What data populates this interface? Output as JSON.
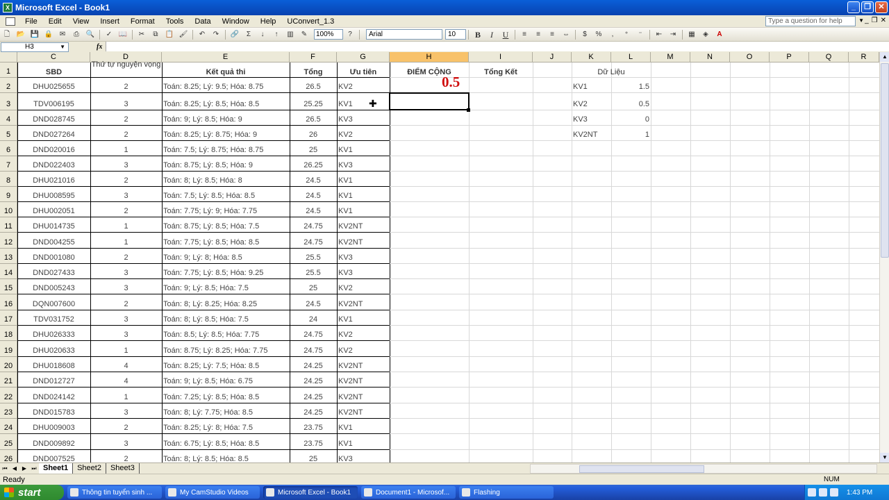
{
  "window": {
    "title": "Microsoft Excel - Book1"
  },
  "menu": {
    "items": [
      "File",
      "Edit",
      "View",
      "Insert",
      "Format",
      "Tools",
      "Data",
      "Window",
      "Help",
      "UConvert_1.3"
    ],
    "help_placeholder": "Type a question for help"
  },
  "toolbar": {
    "zoom": "100%",
    "font": "Arial",
    "size": "10"
  },
  "formula": {
    "namebox": "H3",
    "fx": "fx",
    "value": ""
  },
  "columns": [
    "C",
    "D",
    "E",
    "F",
    "G",
    "H",
    "I",
    "J",
    "K",
    "L",
    "M",
    "N",
    "O",
    "P",
    "Q",
    "R"
  ],
  "rows": [
    "1",
    "2",
    "3",
    "4",
    "5",
    "6",
    "7",
    "8",
    "9",
    "10",
    "11",
    "12",
    "13",
    "14",
    "15",
    "16",
    "17",
    "18",
    "19",
    "20",
    "21",
    "22",
    "23",
    "24",
    "25",
    "26"
  ],
  "headers": {
    "sbd": "SBD",
    "thu_tu": "Thứ tự nguyện vọng",
    "ket_qua": "Kết quả thi",
    "tong": "Tổng",
    "uu_tien": "Ưu tiên",
    "diem_cong": "điểm cộng",
    "tong_ket": "Tổng Kết",
    "du_lieu": "Dữ Liệu"
  },
  "big_value": "0.5",
  "data_rows": [
    {
      "sbd": "DHU025655",
      "tt": "2",
      "kq": "Toán: 8.25; Lý: 9.5; Hóa: 8.75",
      "tong": "26.5",
      "ut": "KV2"
    },
    {
      "sbd": "TDV006195",
      "tt": "3",
      "kq": "Toán: 8.25; Lý: 8.5; Hóa: 8.5",
      "tong": "25.25",
      "ut": "KV1"
    },
    {
      "sbd": "DND028745",
      "tt": "2",
      "kq": "Toán: 9; Lý: 8.5; Hóa: 9",
      "tong": "26.5",
      "ut": "KV3"
    },
    {
      "sbd": "DND027264",
      "tt": "2",
      "kq": "Toán: 8.25; Lý: 8.75; Hóa: 9",
      "tong": "26",
      "ut": "KV2"
    },
    {
      "sbd": "DND020016",
      "tt": "1",
      "kq": "Toán: 7.5; Lý: 8.75; Hóa: 8.75",
      "tong": "25",
      "ut": "KV1"
    },
    {
      "sbd": "DND022403",
      "tt": "3",
      "kq": "Toán: 8.75; Lý: 8.5; Hóa: 9",
      "tong": "26.25",
      "ut": "KV3"
    },
    {
      "sbd": "DHU021016",
      "tt": "2",
      "kq": "Toán: 8; Lý: 8.5; Hóa: 8",
      "tong": "24.5",
      "ut": "KV1"
    },
    {
      "sbd": "DHU008595",
      "tt": "3",
      "kq": "Toán: 7.5; Lý: 8.5; Hóa: 8.5",
      "tong": "24.5",
      "ut": "KV1"
    },
    {
      "sbd": "DHU002051",
      "tt": "2",
      "kq": "Toán: 7.75; Lý: 9; Hóa: 7.75",
      "tong": "24.5",
      "ut": "KV1"
    },
    {
      "sbd": "DHU014735",
      "tt": "1",
      "kq": "Toán: 8.75; Lý: 8.5; Hóa: 7.5",
      "tong": "24.75",
      "ut": "KV2NT"
    },
    {
      "sbd": "DND004255",
      "tt": "1",
      "kq": "Toán: 7.75; Lý: 8.5; Hóa: 8.5",
      "tong": "24.75",
      "ut": "KV2NT"
    },
    {
      "sbd": "DND001080",
      "tt": "2",
      "kq": "Toán: 9; Lý: 8; Hóa: 8.5",
      "tong": "25.5",
      "ut": "KV3"
    },
    {
      "sbd": "DND027433",
      "tt": "3",
      "kq": "Toán: 7.75; Lý: 8.5; Hóa: 9.25",
      "tong": "25.5",
      "ut": "KV3"
    },
    {
      "sbd": "DND005243",
      "tt": "3",
      "kq": "Toán: 9; Lý: 8.5; Hóa: 7.5",
      "tong": "25",
      "ut": "KV2"
    },
    {
      "sbd": "DQN007600",
      "tt": "2",
      "kq": "Toán: 8; Lý: 8.25; Hóa: 8.25",
      "tong": "24.5",
      "ut": "KV2NT"
    },
    {
      "sbd": "TDV031752",
      "tt": "3",
      "kq": "Toán: 8; Lý: 8.5; Hóa: 7.5",
      "tong": "24",
      "ut": "KV1"
    },
    {
      "sbd": "DHU026333",
      "tt": "3",
      "kq": "Toán: 8.5; Lý: 8.5; Hóa: 7.75",
      "tong": "24.75",
      "ut": "KV2"
    },
    {
      "sbd": "DHU020633",
      "tt": "1",
      "kq": "Toán: 8.75; Lý: 8.25; Hóa: 7.75",
      "tong": "24.75",
      "ut": "KV2"
    },
    {
      "sbd": "DHU018608",
      "tt": "4",
      "kq": "Toán: 8.25; Lý: 7.5; Hóa: 8.5",
      "tong": "24.25",
      "ut": "KV2NT"
    },
    {
      "sbd": "DND012727",
      "tt": "4",
      "kq": "Toán: 9; Lý: 8.5; Hóa: 6.75",
      "tong": "24.25",
      "ut": "KV2NT"
    },
    {
      "sbd": "DND024142",
      "tt": "1",
      "kq": "Toán: 7.25; Lý: 8.5; Hóa: 8.5",
      "tong": "24.25",
      "ut": "KV2NT"
    },
    {
      "sbd": "DND015783",
      "tt": "3",
      "kq": "Toán: 8; Lý: 7.75; Hóa: 8.5",
      "tong": "24.25",
      "ut": "KV2NT"
    },
    {
      "sbd": "DHU009003",
      "tt": "2",
      "kq": "Toán: 8.25; Lý: 8; Hóa: 7.5",
      "tong": "23.75",
      "ut": "KV1"
    },
    {
      "sbd": "DND009892",
      "tt": "3",
      "kq": "Toán: 6.75; Lý: 8.5; Hóa: 8.5",
      "tong": "23.75",
      "ut": "KV1"
    },
    {
      "sbd": "DND007525",
      "tt": "2",
      "kq": "Toán: 8; Lý: 8.5; Hóa: 8.5",
      "tong": "25",
      "ut": "KV3"
    }
  ],
  "lookup": [
    {
      "k": "KV1",
      "v": "1.5"
    },
    {
      "k": "KV2",
      "v": "0.5"
    },
    {
      "k": "KV3",
      "v": "0"
    },
    {
      "k": "KV2NT",
      "v": "1"
    }
  ],
  "sheets": [
    "Sheet1",
    "Sheet2",
    "Sheet3"
  ],
  "status": {
    "ready": "Ready",
    "num": "NUM"
  },
  "taskbar": {
    "start": "start",
    "items": [
      "Thông tin tuyển sinh ...",
      "My CamStudio Videos",
      "Microsoft Excel - Book1",
      "Document1 - Microsof...",
      "Flashing"
    ],
    "clock": "1:43 PM"
  }
}
